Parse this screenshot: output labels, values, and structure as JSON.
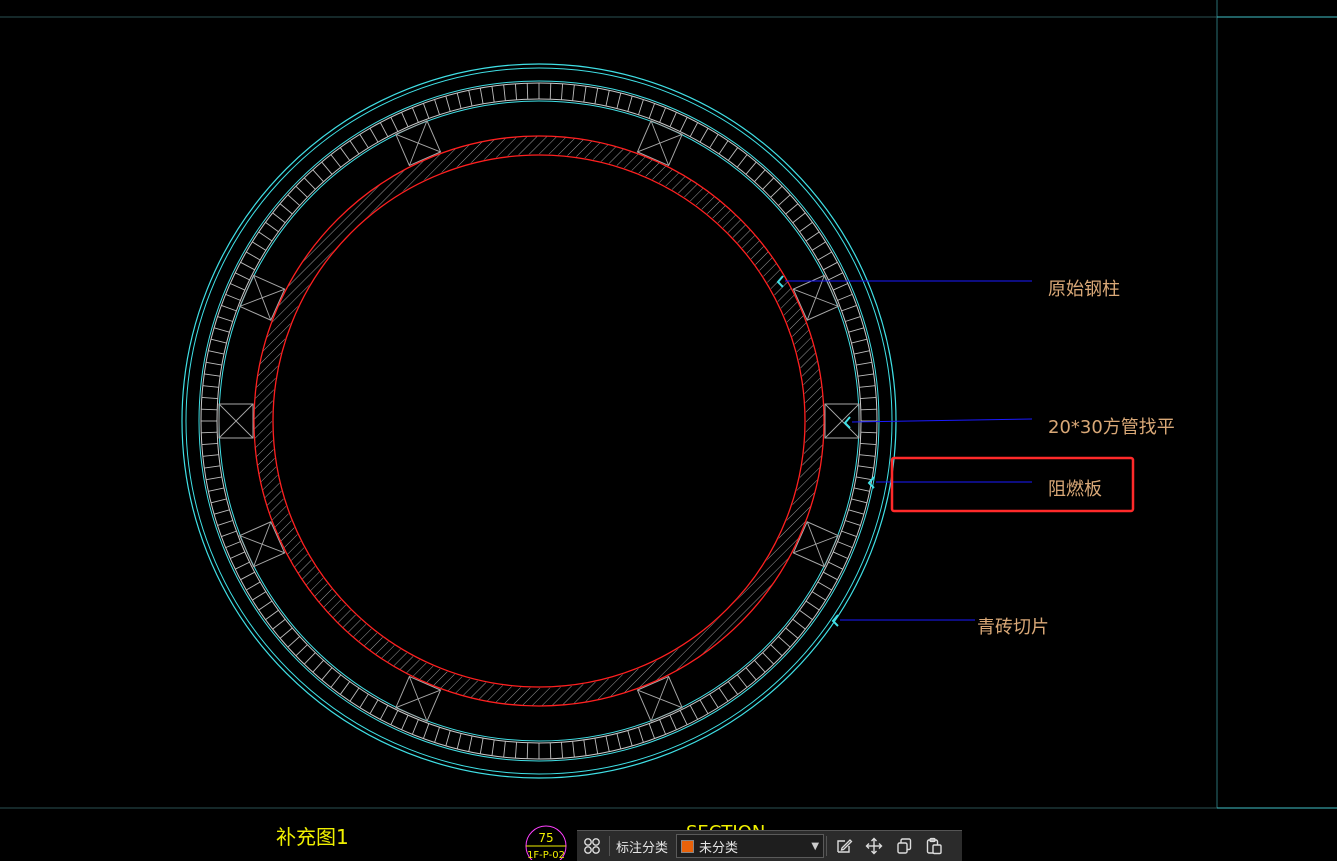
{
  "drawing": {
    "callouts": [
      {
        "label": "原始钢柱"
      },
      {
        "label": "20*30方管找平"
      },
      {
        "label": "阻燃板"
      },
      {
        "label": "青砖切片"
      }
    ],
    "footer": {
      "caption": "补充图1",
      "bubble_number": "75",
      "bubble_ref": "1F-P-02",
      "section_text": "SECTION"
    },
    "colors": {
      "background": "#000000",
      "cyan_lines": "#40e0e6",
      "red_lines": "#ff2020",
      "hatch": "#c8c8c8",
      "leader": "#1a1aff",
      "label_text": "#d9a877",
      "highlight_box": "#ff2a2a",
      "caption_text": "#f0f000"
    }
  },
  "toolbar": {
    "category_label": "标注分类",
    "category_value": "未分类",
    "category_color": "#e8620a",
    "icons": [
      "grid-icon",
      "edit-icon",
      "move-icon",
      "copy-icon",
      "paste-icon"
    ]
  }
}
